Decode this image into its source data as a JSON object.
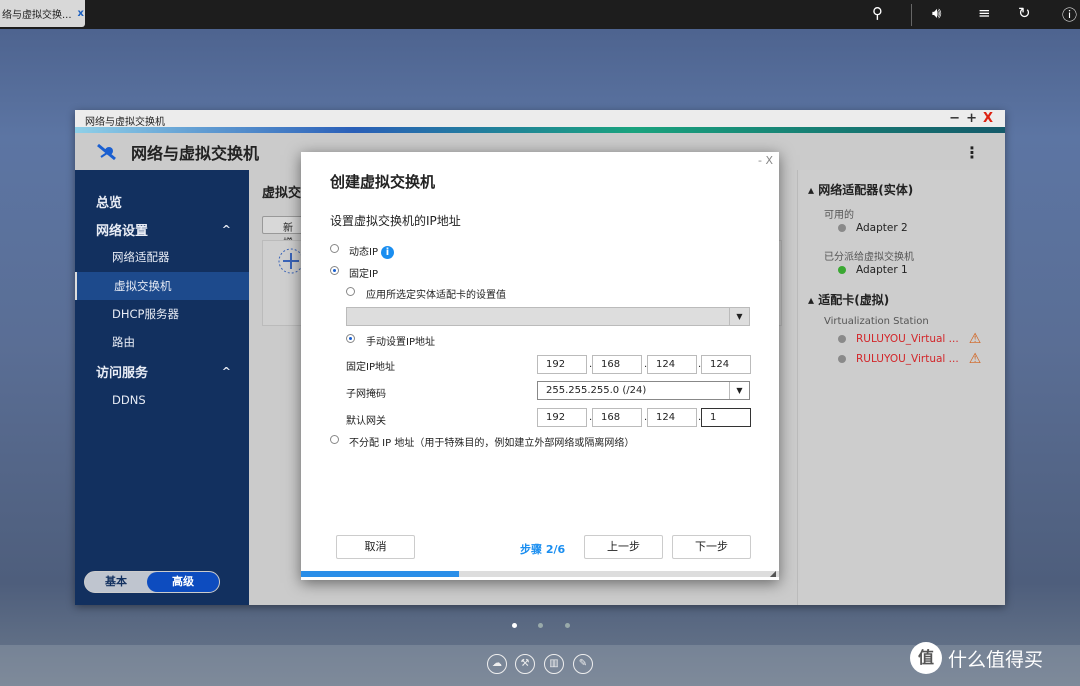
{
  "topbar": {
    "tab_label": "络与虚拟交换...",
    "tab_close": "x",
    "icons": [
      "search-icon",
      "volume-icon",
      "notifications-icon",
      "sync-icon",
      "info-icon"
    ]
  },
  "window": {
    "title": "网络与虚拟交换机",
    "app_title": "网络与虚拟交换机",
    "controls": {
      "min": "−",
      "max": "+",
      "close": "X"
    }
  },
  "sidebar": {
    "items": [
      {
        "label": "总览",
        "type": "top"
      },
      {
        "label": "网络设置",
        "type": "top",
        "chev": "^"
      },
      {
        "label": "网络适配器",
        "type": "sub"
      },
      {
        "label": "虚拟交换机",
        "type": "sub",
        "selected": true
      },
      {
        "label": "DHCP服务器",
        "type": "sub"
      },
      {
        "label": "路由",
        "type": "sub"
      },
      {
        "label": "访问服务",
        "type": "top",
        "chev": "^"
      },
      {
        "label": "DDNS",
        "type": "sub"
      }
    ],
    "mode_basic": "基本",
    "mode_advanced": "高级"
  },
  "main": {
    "title": "虚拟交",
    "new_button": "新增"
  },
  "right_panel": {
    "physical_header": "网络适配器(实体)",
    "available_label": "可用的",
    "available": [
      "Adapter 2"
    ],
    "assigned_label": "已分派给虚拟交换机",
    "assigned": [
      "Adapter 1"
    ],
    "virtual_header": "适配卡(虚拟)",
    "vs_label": "Virtualization Station",
    "virtual": [
      "RULUYOU_Virtual ...",
      "RULUYOU_Virtual ..."
    ],
    "colors": {
      "assigned": "#3aa832",
      "warning": "#d2601a"
    }
  },
  "dialog": {
    "close": "- X",
    "title": "创建虚拟交换机",
    "subtitle": "设置虚拟交换机的IP地址",
    "opt_dynamic": "动态IP",
    "opt_static": "固定IP",
    "opt_apply": "应用所选定实体适配卡的设置值",
    "opt_manual": "手动设置IP地址",
    "ip_label": "固定IP地址",
    "ip": [
      "192",
      "168",
      "124",
      "124"
    ],
    "mask_label": "子网掩码",
    "mask": "255.255.255.0 (/24)",
    "gw_label": "默认网关",
    "gw": [
      "192",
      "168",
      "124",
      "1"
    ],
    "opt_none": "不分配 IP 地址（用于特殊目的，例如建立外部网络或隔离网络）",
    "cancel": "取消",
    "step": "步骤 2/6",
    "prev": "上一步",
    "next": "下一步",
    "progress": 0.33
  },
  "dock": {
    "page_count": 3,
    "active_page": 1
  },
  "watermark": {
    "text": "什么值得买",
    "logo": "值"
  }
}
